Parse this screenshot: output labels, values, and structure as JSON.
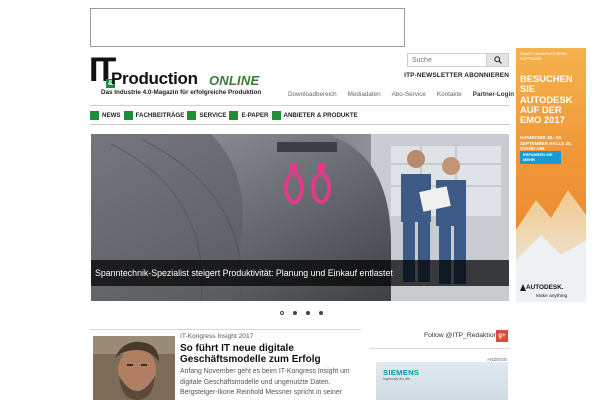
{
  "search": {
    "placeholder": "Suche"
  },
  "header": {
    "newsletter_label": "ITP-NEWSLETTER ABONNIEREN",
    "logo": {
      "it": "IT",
      "amp": "&",
      "production": "Production",
      "online": "ONLINE",
      "tagline": "Das Industrie 4.0-Magazin für erfolgreiche Produktion"
    }
  },
  "topnav": {
    "items": [
      "Downloadbereich",
      "Mediadaten",
      "Abo-Service",
      "Kontakte"
    ],
    "login": "Partner-Login"
  },
  "mainnav": {
    "items": [
      "NEWS",
      "FACHBEITRÄGE",
      "SERVICE",
      "E-PAPER",
      "ANBIETER & PRODUKTE"
    ]
  },
  "hero": {
    "caption": "Spanntechnik-Spezialist steigert Produktivität: Planung und Einkauf entlastet",
    "slide_count": 4,
    "active_slide": 1
  },
  "article": {
    "kicker": "IT-Kongress Insight 2017",
    "headline": "So führt IT neue digitale Geschäftsmodelle zum Erfolg",
    "teaser": "Anfang November geht es beim IT-Kongress Insight um digitale Geschäftsmodelle und ungenutzte Daten. Bergsteiger-Ikone Reinhold Messner spricht in seiner"
  },
  "social": {
    "follow_label": "Follow @ITP_Redaktion",
    "gplus_label": "g+"
  },
  "right_ad": {
    "label": "ANZEIGE",
    "brand": "SIEMENS",
    "slogan": "Ingenuity for life"
  },
  "side_ad": {
    "small": "SMART MANUFACTURING SOFTWARE",
    "big": "BESUCHEN SIE AUTODESK AUF DER EMO 2017",
    "date": "HANNOVER 18.–23. SEPTEMBER HALLE 25, STAND A58",
    "button": "ERFAHREN SIE MEHR",
    "brand": "AUTODESK.",
    "make": "Make anything"
  },
  "colors": {
    "nav_green": "#1f8f37",
    "online_green": "#3b7a34",
    "ad_orange": "#f09637",
    "siemens_teal": "#009999"
  }
}
